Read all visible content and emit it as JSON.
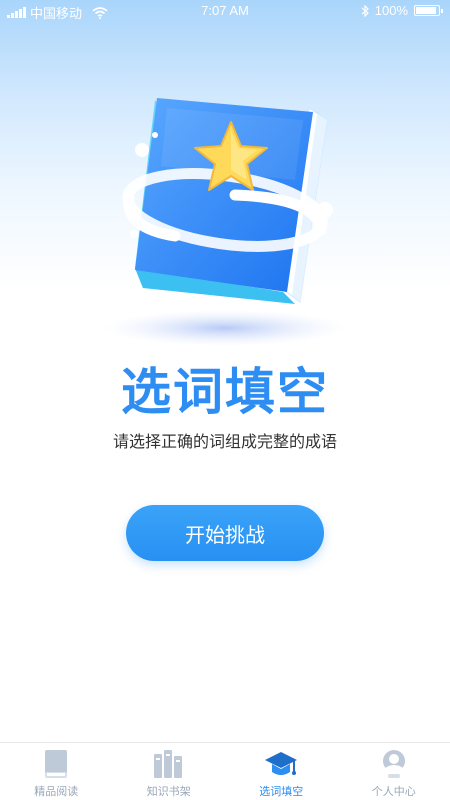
{
  "status_bar": {
    "carrier": "中国移动",
    "time": "7:07 AM",
    "battery": "100%",
    "signal_icon": "signal-icon",
    "wifi_icon": "wifi-icon",
    "bluetooth_icon": "bluetooth-icon"
  },
  "hero": {
    "illustration": "book-star-illustration",
    "title": "选词填空",
    "subtitle": "请选择正确的词组成完整的成语"
  },
  "start_button": {
    "label": "开始挑战"
  },
  "tabs": [
    {
      "label": "精品阅读",
      "icon": "book-icon",
      "active": false
    },
    {
      "label": "知识书架",
      "icon": "bookshelf-icon",
      "active": false
    },
    {
      "label": "选词填空",
      "icon": "graduation-cap-icon",
      "active": true
    },
    {
      "label": "个人中心",
      "icon": "user-icon",
      "active": false
    }
  ],
  "colors": {
    "accent": "#2e8df3",
    "button": "#2890f2",
    "tab_active": "#2a8ef2",
    "tab_inactive": "#9aa7b8"
  }
}
